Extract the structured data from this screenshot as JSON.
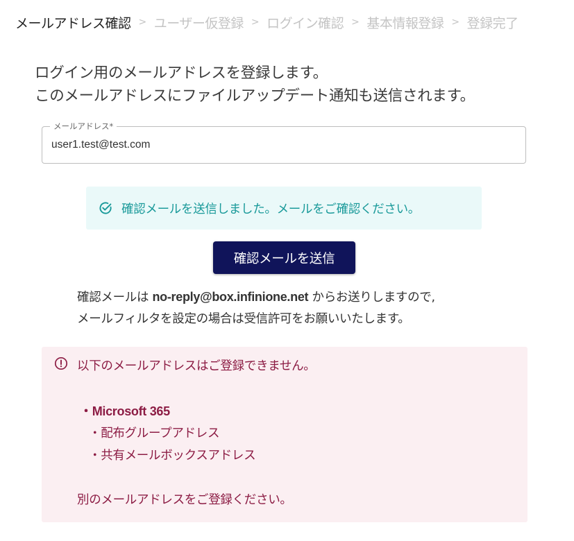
{
  "steps": [
    {
      "label": "メールアドレス確認",
      "active": true
    },
    {
      "label": "ユーザー仮登録",
      "active": false
    },
    {
      "label": "ログイン確認",
      "active": false
    },
    {
      "label": "基本情報登録",
      "active": false
    },
    {
      "label": "登録完了",
      "active": false
    }
  ],
  "step_separator": ">",
  "intro": {
    "line1": "ログイン用のメールアドレスを登録します。",
    "line2": "このメールアドレスにファイルアップデート通知も送信されます。"
  },
  "email_field": {
    "label": "メールアドレス*",
    "value": "user1.test@test.com"
  },
  "success_alert": {
    "icon": "check-circle-icon",
    "text": "確認メールを送信しました。メールをご確認ください。",
    "color": "#1a9a9a"
  },
  "send_button": {
    "label": "確認メールを送信",
    "color": "#10145a"
  },
  "note": {
    "line1_prefix": "確認メールは ",
    "sender": "no-reply@box.infinione.net",
    "line1_suffix": " からお送りしますので,",
    "line2": "メールフィルタを設定の場合は受信許可をお願いいたします。"
  },
  "warning_alert": {
    "icon": "exclamation-circle-icon",
    "title": "以下のメールアドレスはご登録できません。",
    "item_main": "・Microsoft 365",
    "sub_items": [
      "・配布グループアドレス",
      "・共有メールボックスアドレス"
    ],
    "footer": "別のメールアドレスをご登録ください。",
    "color": "#8c1c44"
  }
}
